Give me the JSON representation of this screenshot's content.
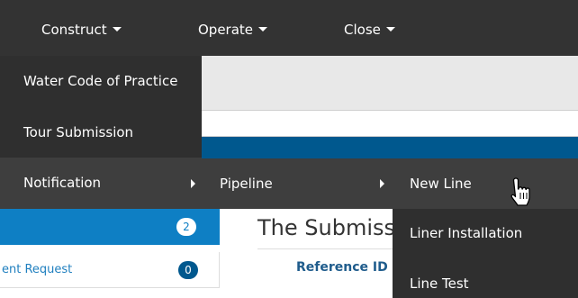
{
  "navbar": {
    "items": [
      {
        "label": "Construct"
      },
      {
        "label": "Operate"
      },
      {
        "label": "Close"
      }
    ]
  },
  "menu_level1": {
    "items": [
      {
        "label": "Water Code of Practice"
      },
      {
        "label": "Tour Submission"
      },
      {
        "label": "Notification"
      }
    ]
  },
  "menu_level2": {
    "items": [
      {
        "label": "Pipeline"
      }
    ]
  },
  "menu_level3": {
    "items": [
      {
        "label": "New Line"
      },
      {
        "label": "Liner Installation"
      },
      {
        "label": "Line Test"
      }
    ]
  },
  "left_panel": {
    "active_badge": "2",
    "link_text": "ent Request",
    "link_badge": "0"
  },
  "main": {
    "title": "The Submissi",
    "table_header_ref": "Reference ID"
  },
  "colors": {
    "navbar_bg": "#333333",
    "menu_bg": "#2f2f2f",
    "accent_blue": "#0e7fc4",
    "dark_blue": "#00588e"
  },
  "icons": {
    "cursor": "hand-pointer-icon",
    "caret": "caret-down-icon",
    "submenu_arrow": "caret-right-icon"
  }
}
